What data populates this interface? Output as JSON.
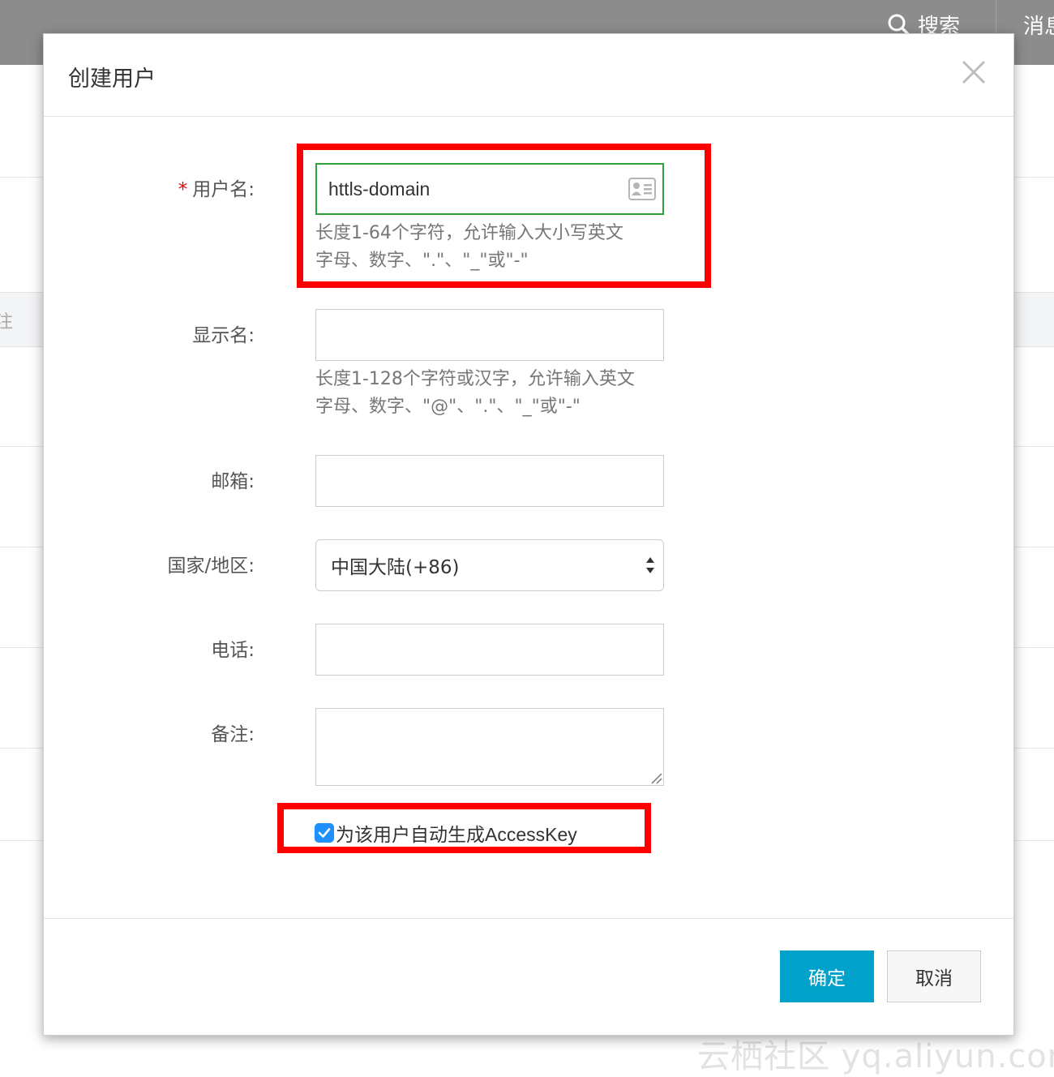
{
  "topbar": {
    "search_label": "搜索",
    "message_label": "消息"
  },
  "background": {
    "band_label": "注"
  },
  "watermark": "云栖社区 yq.aliyun.com",
  "dialog": {
    "title": "创建用户",
    "fields": {
      "username": {
        "required_mark": "*",
        "label": "用户名:",
        "value": "httls-domain",
        "hint_line1": "长度1-64个字符，允许输入大小写英文",
        "hint_line2": "字母、数字、\".\"、\"_\"或\"-\""
      },
      "display_name": {
        "label": "显示名:",
        "value": "",
        "hint_line1": "长度1-128个字符或汉字，允许输入英文",
        "hint_line2": "字母、数字、\"@\"、\".\"、\"_\"或\"-\""
      },
      "email": {
        "label": "邮箱:",
        "value": ""
      },
      "country": {
        "label": "国家/地区:",
        "selected": "中国大陆(+86)"
      },
      "phone": {
        "label": "电话:",
        "value": ""
      },
      "remark": {
        "label": "备注:",
        "value": ""
      }
    },
    "auto_accesskey": {
      "checked": true,
      "label": "为该用户自动生成AccessKey"
    },
    "buttons": {
      "ok": "确定",
      "cancel": "取消"
    }
  },
  "colors": {
    "primary_button": "#00a2ca",
    "highlight_box": "#ff0000",
    "active_input_border": "#2fa23b",
    "checkbox": "#1e90ff"
  }
}
